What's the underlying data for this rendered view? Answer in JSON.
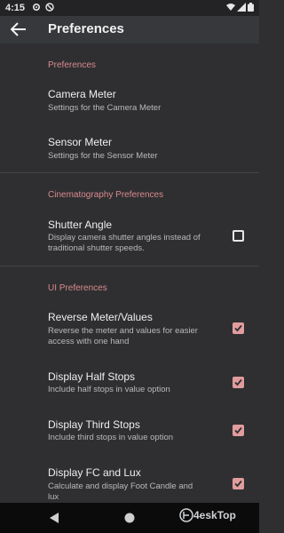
{
  "status_bar": {
    "time": "4:15"
  },
  "app_bar": {
    "title": "Preferences"
  },
  "sections": {
    "preferences": "Preferences",
    "cinematography": "Cinematography Preferences",
    "ui": "UI Preferences"
  },
  "items": {
    "camera_meter": {
      "title": "Camera Meter",
      "subtitle": "Settings for the Camera Meter"
    },
    "sensor_meter": {
      "title": "Sensor Meter",
      "subtitle": "Settings for the Sensor Meter"
    },
    "shutter_angle": {
      "title": "Shutter Angle",
      "subtitle_1": "Display camera shutter angles instead of",
      "subtitle_2": "traditional shutter speeds.",
      "checked": false
    },
    "reverse_meter": {
      "title": "Reverse Meter/Values",
      "subtitle_1": "Reverse the meter and values for easier",
      "subtitle_2": "access with one hand",
      "checked": true
    },
    "half_stops": {
      "title": "Display Half Stops",
      "subtitle": "Include half stops in value option",
      "checked": true
    },
    "third_stops": {
      "title": "Display Third Stops",
      "subtitle": "Include third stops in value option",
      "checked": true
    },
    "fc_lux": {
      "title": "Display FC and Lux",
      "subtitle_1": "Calculate and display Foot Candle and",
      "subtitle_2": "lux",
      "checked": true
    }
  },
  "watermark": {
    "text": "4eskTop"
  },
  "colors": {
    "accent": "#e19c9e",
    "section_text": "#d88a8e",
    "background": "#2f2f31"
  }
}
